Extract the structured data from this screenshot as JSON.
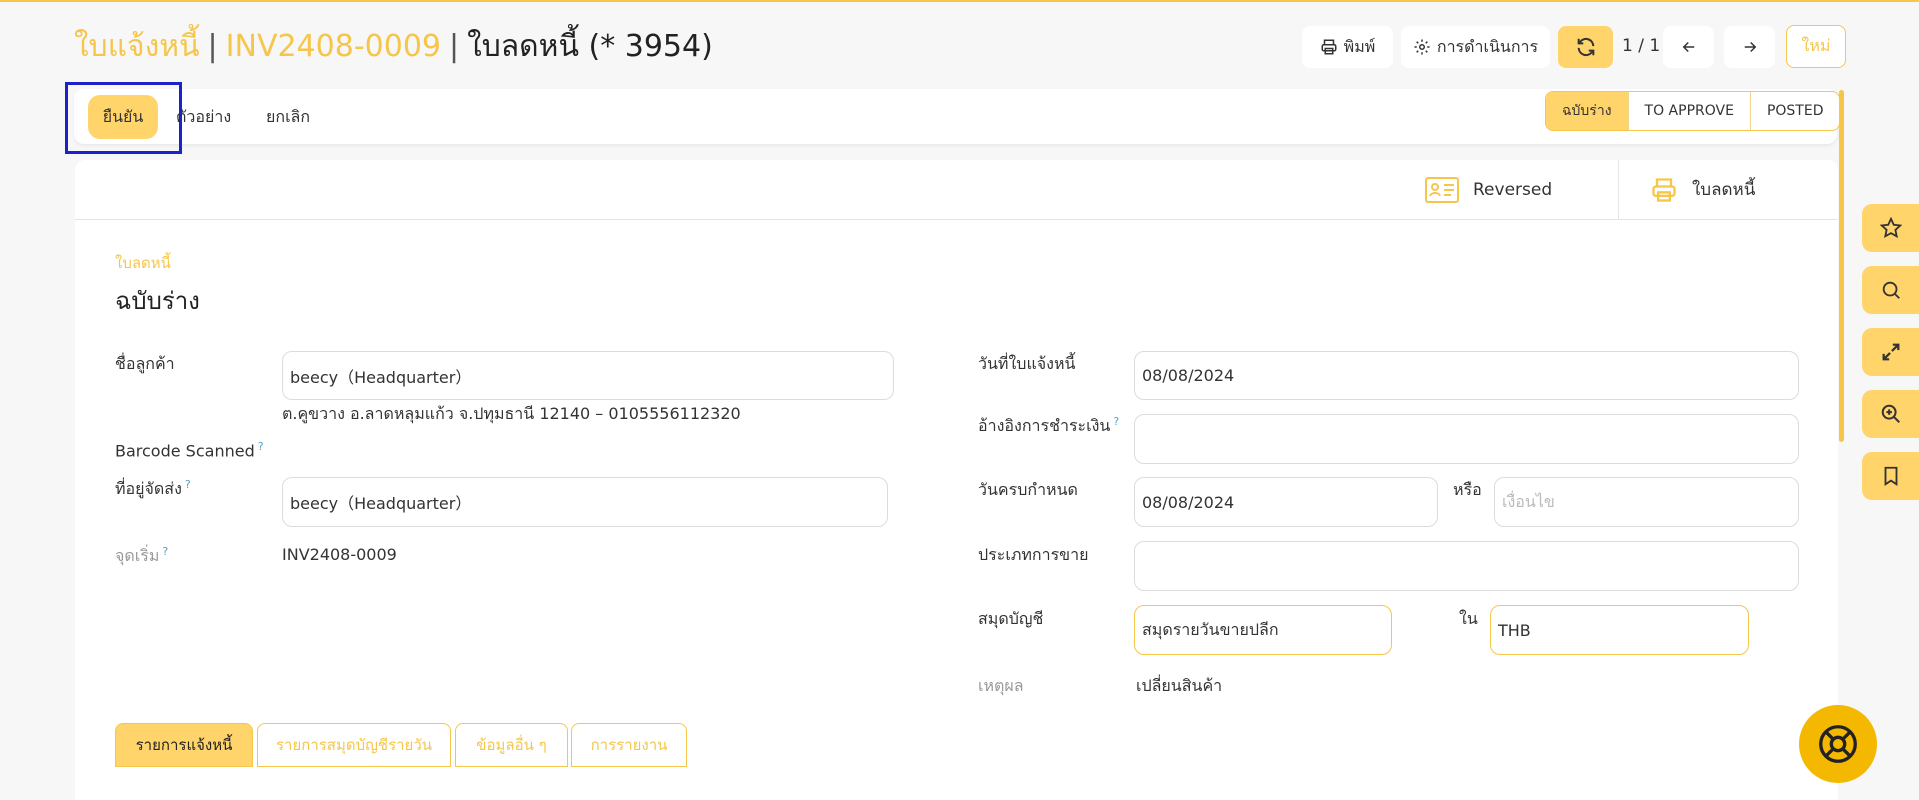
{
  "header": {
    "crumb1": "ใบแจ้งหนี้",
    "crumb2": "INV2408-0009",
    "title": "ใบลดหนี้ (* 3954)"
  },
  "toolbar": {
    "print": "พิมพ์",
    "actions": "การดำเนินการ",
    "pager": "1 / 1",
    "new": "ใหม่"
  },
  "actions": {
    "confirm": "ยืนยัน",
    "preview": "ตัวอย่าง",
    "cancel": "ยกเลิก"
  },
  "status": [
    "ฉบับร่าง",
    "TO APPROVE",
    "POSTED"
  ],
  "smart_buttons": {
    "reversed": "Reversed",
    "credit_note": "ใบลดหนี้"
  },
  "form": {
    "type_label": "ใบลดหนี้",
    "state": "ฉบับร่าง",
    "customer_label": "ชื่อลูกค้า",
    "customer_value": "beecy（Headquarter）",
    "customer_address": "ต.คูขวาง อ.ลาดหลุมแก้ว จ.ปทุมธานี 12140 – 0105556112320",
    "barcode_label": "Barcode Scanned",
    "delivery_label": "ที่อยู่จัดส่ง",
    "delivery_value": "beecy（Headquarter）",
    "origin_label": "จุดเริ่ม",
    "origin_value": "INV2408-0009",
    "invoice_date_label": "วันที่ใบแจ้งหนี้",
    "invoice_date_value": "08/08/2024",
    "payment_ref_label": "อ้างอิงการชำระเงิน",
    "payment_ref_value": "",
    "due_date_label": "วันครบกำหนด",
    "due_date_value": "08/08/2024",
    "or_label": "หรือ",
    "terms_placeholder": "เงื่อนไข",
    "sale_type_label": "ประเภทการขาย",
    "sale_type_value": "",
    "journal_label": "สมุดบัญชี",
    "journal_value": "สมุดรายวันขายปลีก",
    "in_label": "ใน",
    "currency_value": "THB",
    "reason_label": "เหตุผล",
    "reason_value": "เปลี่ยนสินค้า",
    "help_mark": "?"
  },
  "tabs": [
    "รายการแจ้งหนี้",
    "รายการสมุดบัญชีรายวัน",
    "ข้อมูลอื่น ๆ",
    "การรายงาน"
  ],
  "colors": {
    "accent": "#f5c64a",
    "accent_fill": "#ffd46a",
    "focus": "#1b22c9"
  }
}
